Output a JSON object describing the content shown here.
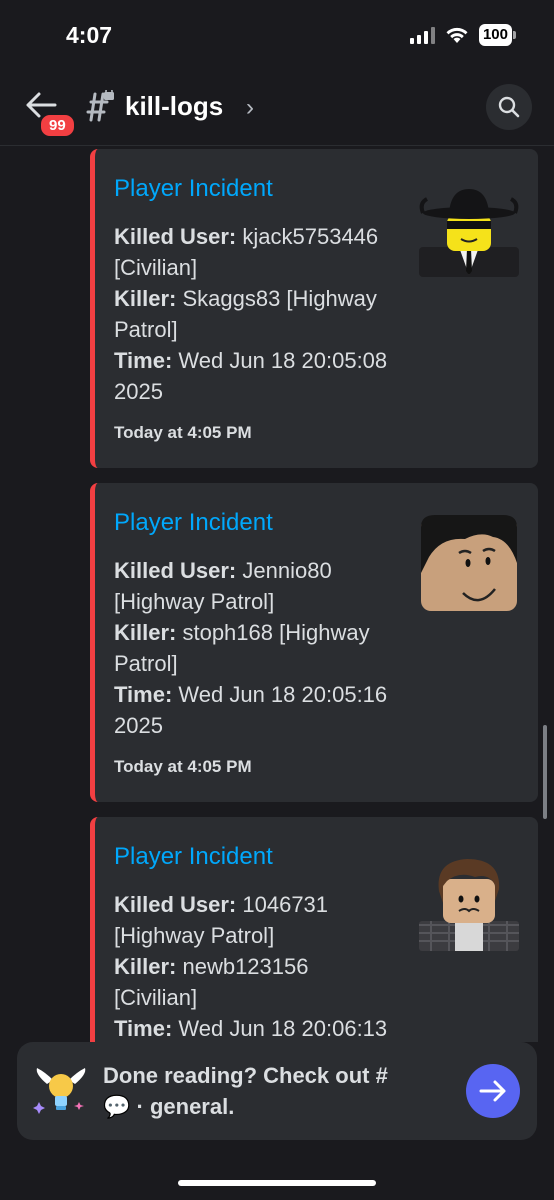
{
  "status_bar": {
    "time": "4:07",
    "battery": "100"
  },
  "header": {
    "badge_count": "99",
    "channel_name": "kill-logs",
    "chevron": "›"
  },
  "embeds": [
    {
      "title": "Player Incident",
      "killed_user_label": "Killed User:",
      "killed_user_line1": " kjack5753446",
      "killed_user_line2": "[Civilian]",
      "killer_label": "Killer:",
      "killer_line1": " Skaggs83 [Highway",
      "killer_line2": "Patrol]",
      "time_label": "Time:",
      "time_line1": " Wed Jun 18 20:05:08",
      "time_line2": "2025",
      "footer": "Today at 4:05 PM",
      "avatar_icon": "cowboy-avatar-icon"
    },
    {
      "title": "Player Incident",
      "killed_user_label": "Killed User:",
      "killed_user_line1": " Jennio80",
      "killed_user_line2": "[Highway Patrol]",
      "killer_label": "Killer:",
      "killer_line1": " stoph168 [Highway",
      "killer_line2": "Patrol]",
      "time_label": "Time:",
      "time_line1": " Wed Jun 18 20:05:16",
      "time_line2": "2025",
      "footer": "Today at 4:05 PM",
      "avatar_icon": "smiling-avatar-icon"
    },
    {
      "title": "Player Incident",
      "killed_user_label": "Killed User:",
      "killed_user_line1": " 1046731",
      "killed_user_line2": "[Highway Patrol]",
      "killer_label": "Killer:",
      "killer_line1": " newb123156",
      "killer_line2": "[Civilian]",
      "time_label": "Time:",
      "time_line1": " Wed Jun 18 20:06:13",
      "avatar_icon": "brown-hair-avatar-icon"
    }
  ],
  "banner": {
    "line1": "Done reading? Check out #",
    "line2": " · general.",
    "bubble_icon": "💬"
  },
  "colors": {
    "background": "#1a1a1e",
    "embed": "#2b2d31",
    "embed_accent": "#f23f42",
    "title_link": "#00a8fc",
    "send_button": "#5865f2"
  }
}
